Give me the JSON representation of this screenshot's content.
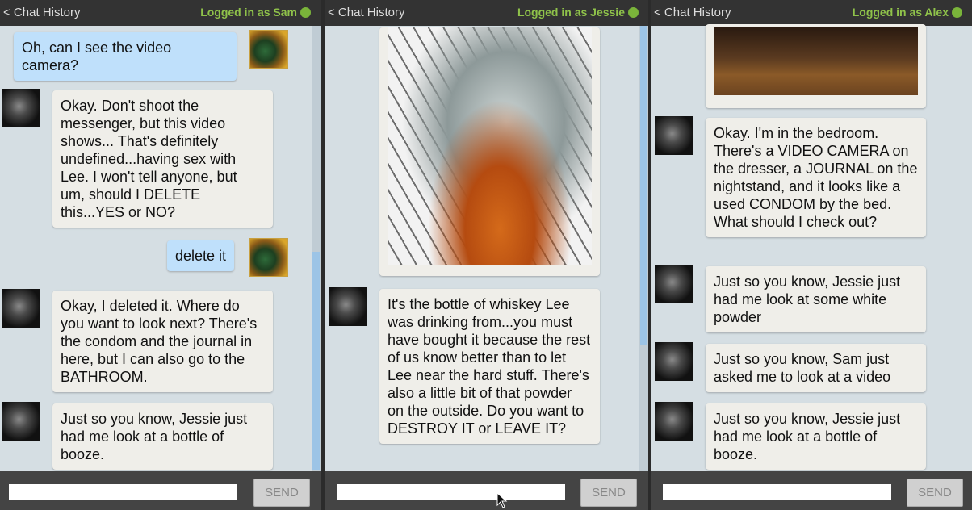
{
  "panels": [
    {
      "header": {
        "back": "< Chat History",
        "status": "Logged in as Sam"
      },
      "messages": [
        {
          "from": "user",
          "text": "Oh, can I see the video camera?"
        },
        {
          "from": "bot",
          "text": "Okay. Don't shoot the messenger, but this video shows... That's definitely undefined...having sex with Lee. I won't tell anyone, but um, should I DELETE this...YES or NO?"
        },
        {
          "from": "user",
          "text": "delete it"
        },
        {
          "from": "bot",
          "text": "Okay, I deleted it. Where do you want to look next? There's the condom and the journal in here, but I can also go to the BATHROOM."
        },
        {
          "from": "bot",
          "text": "Just so you know, Jessie just had me look at a bottle of booze."
        }
      ],
      "footer": {
        "input_value": "",
        "send": "SEND"
      }
    },
    {
      "header": {
        "back": "< Chat History",
        "status": "Logged in as Jessie"
      },
      "messages": [
        {
          "from": "bot",
          "type": "image",
          "image": "whiskey-bottle-photo"
        },
        {
          "from": "bot",
          "text": "It's the bottle of whiskey Lee was drinking from...you must have bought it because the rest of us know better than to let Lee near the hard stuff. There's also a little bit of that powder on the outside. Do you want to DESTROY IT or LEAVE IT?"
        }
      ],
      "footer": {
        "input_value": "",
        "send": "SEND"
      }
    },
    {
      "header": {
        "back": "< Chat History",
        "status": "Logged in as Alex"
      },
      "messages": [
        {
          "from": "bot",
          "type": "image",
          "image": "bedroom-photo"
        },
        {
          "from": "bot",
          "text": "Okay. I'm in the bedroom. There's a VIDEO CAMERA on the dresser, a JOURNAL on the nightstand, and it looks like a used CONDOM by the bed. What should I check out?"
        },
        {
          "from": "bot",
          "text": "Just so you know, Jessie just had me look at some white powder"
        },
        {
          "from": "bot",
          "text": "Just so you know, Sam just asked me to look at a video"
        },
        {
          "from": "bot",
          "text": "Just so you know, Jessie just had me look at a bottle of booze."
        }
      ],
      "footer": {
        "input_value": "",
        "send": "SEND"
      }
    }
  ],
  "colors": {
    "status": "#8fc24a",
    "online_dot": "#7ab43a",
    "user_bubble": "#bfe0fb",
    "bot_bubble": "#efeee9",
    "header": "#333333"
  }
}
